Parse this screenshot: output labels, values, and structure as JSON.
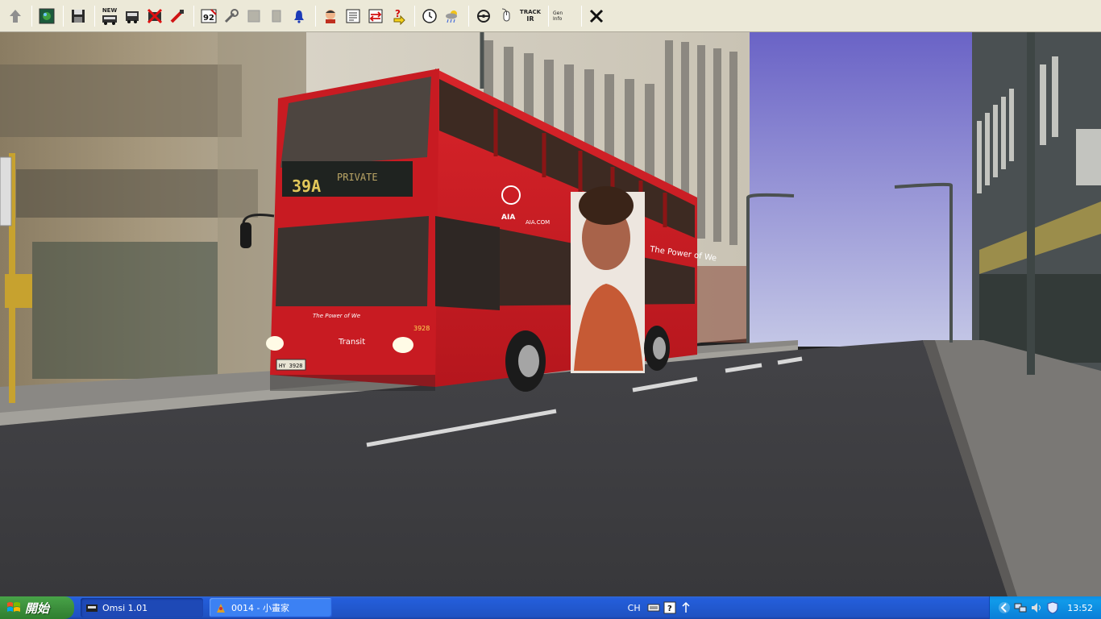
{
  "toolbar": {
    "new_label": "NEW",
    "route_number_label": "92",
    "track_label_1": "TRACK",
    "track_label_2": "IR",
    "mini_label_1": "Gen",
    "mini_label_2": "Info"
  },
  "bus": {
    "destination_route": "39A",
    "destination_text": "PRIVATE",
    "fleet_number": "3928",
    "plate": "HY 3928",
    "operator_name": "Transit",
    "slogan": "The Power of We",
    "brand_logo": "AIA",
    "brand_site": "AIA.COM",
    "ad_slogan": "The Power of We"
  },
  "taskbar": {
    "start_label": "開始",
    "tasks": [
      {
        "label": "Omsi 1.01",
        "state": "active"
      },
      {
        "label": "0014 - 小畫家",
        "state": "inactive"
      }
    ],
    "language": "CH",
    "clock": "13:52"
  },
  "colors": {
    "bus_red": "#c81b22",
    "sky_top": "#6a63c6",
    "sky_bottom": "#c4c7e6",
    "road": "#3b3b3e",
    "toolbar_bg": "#ece9d8",
    "taskbar_blue": "#245edb"
  }
}
